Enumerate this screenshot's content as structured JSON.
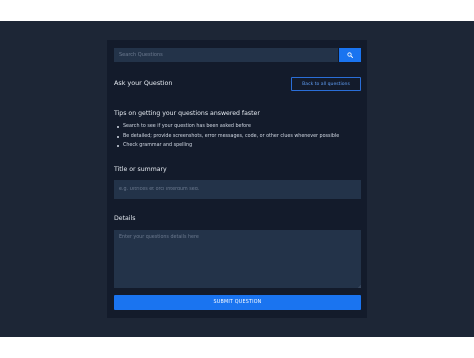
{
  "search": {
    "placeholder": "Search Questions",
    "button_icon": "search-icon"
  },
  "header": {
    "title": "Ask your Question",
    "back_label": "Back to all questions"
  },
  "tips": {
    "title": "Tips on getting your questions answered faster",
    "items": [
      "Search to see if your question has been asked before",
      "Be detailed; provide screenshots, error messages, code, or other clues whenever possible",
      "Check grammar and spelling"
    ]
  },
  "form": {
    "title_label": "Title or summary",
    "title_placeholder": "e.g. Ultrices et orci interdum sed.",
    "details_label": "Details",
    "details_placeholder": "Enter your questions details here",
    "submit_label": "SUBMIT QUESTION"
  },
  "colors": {
    "background": "#1d2636",
    "panel": "#131b2b",
    "input": "#233349",
    "accent": "#1a74f0"
  }
}
